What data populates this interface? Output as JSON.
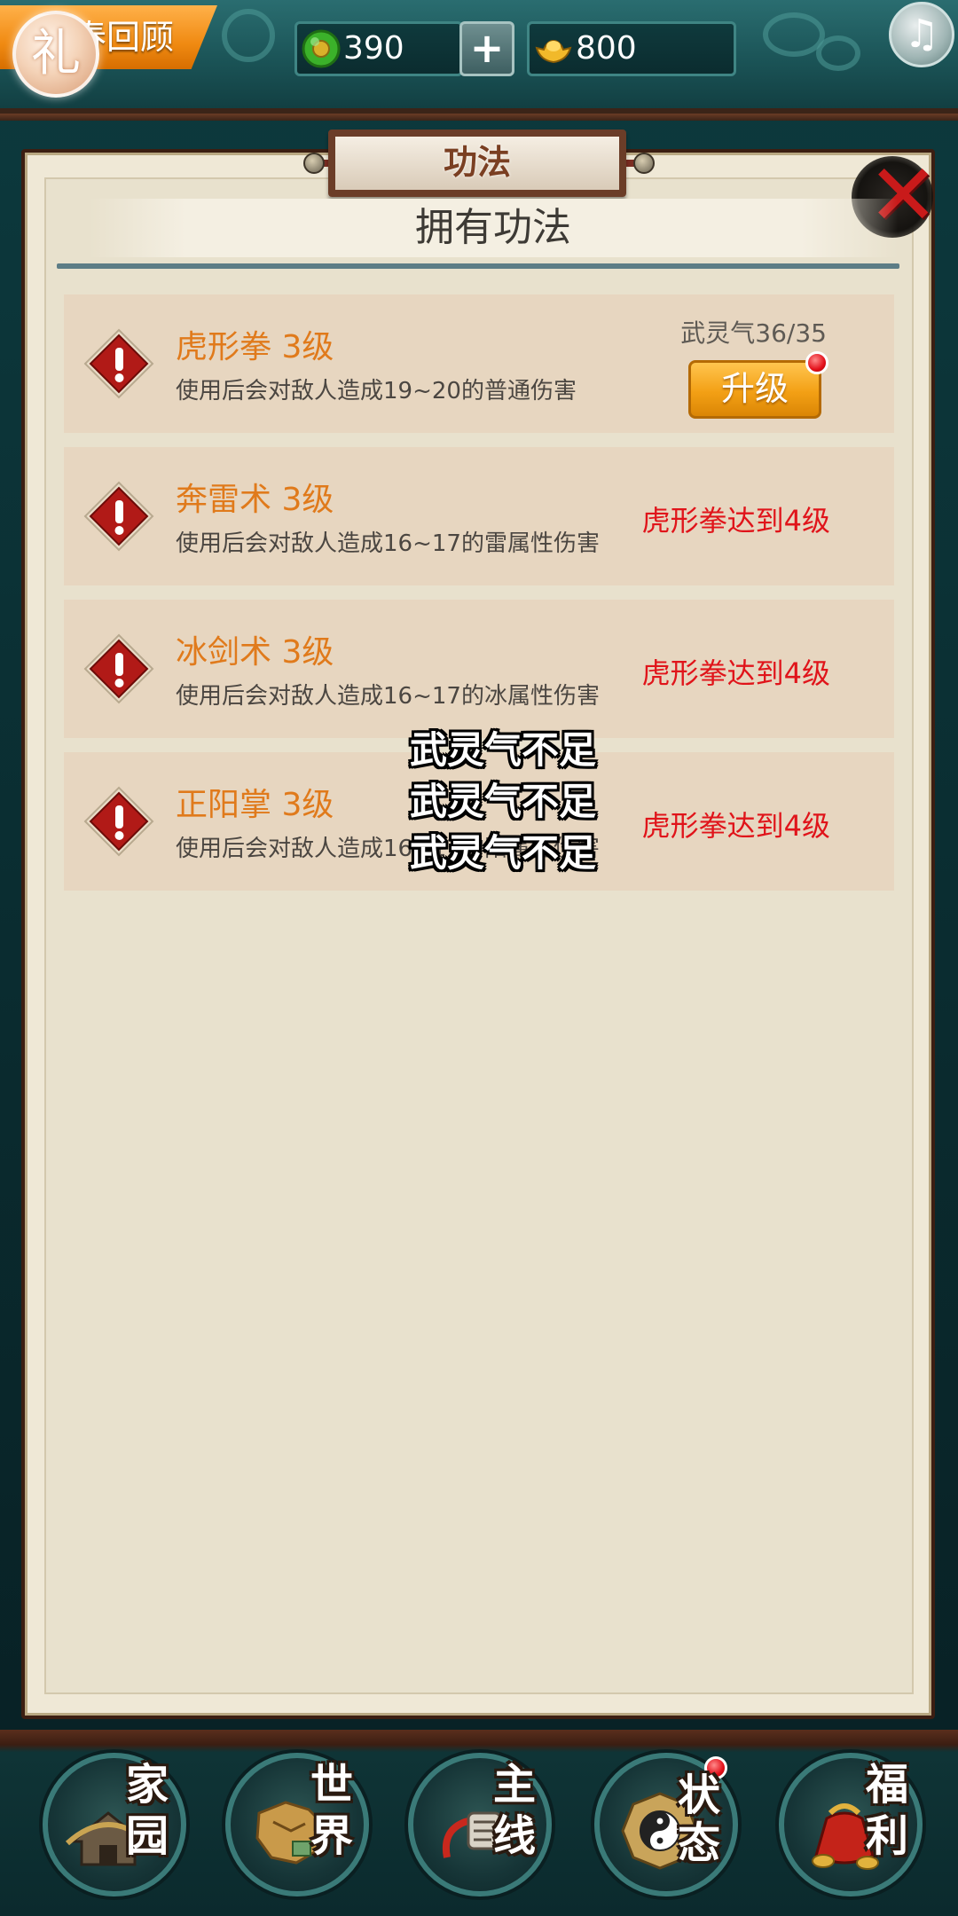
{
  "top_bar": {
    "event_label": "春回顾",
    "gift_icon_char": "礼",
    "jade_amount": "390",
    "plus_label": "+",
    "gold_amount": "800",
    "music_icon_char": "♫"
  },
  "panel": {
    "title": "功法",
    "section_header": "拥有功法",
    "close_icon_char": "✕"
  },
  "skills": [
    {
      "name": "虎形拳 3级",
      "description": "使用后会对敌人造成19~20的普通伤害",
      "qi_label": "武灵气36/35",
      "upgrade_label": "升级"
    },
    {
      "name": "奔雷术 3级",
      "description": "使用后会对敌人造成16~17的雷属性伤害",
      "requirement": "虎形拳达到4级"
    },
    {
      "name": "冰剑术 3级",
      "description": "使用后会对敌人造成16~17的冰属性伤害",
      "requirement": "虎形拳达到4级"
    },
    {
      "name": "正阳掌 3级",
      "description": "使用后会对敌人造成16~17的阳属性伤害",
      "requirement": "虎形拳达到4级"
    }
  ],
  "toasts": [
    "武灵气不足",
    "武灵气不足",
    "武灵气不足"
  ],
  "bottom_nav": [
    {
      "label_top": "家",
      "label_bottom": "园",
      "icon": "home-icon"
    },
    {
      "label_top": "世",
      "label_bottom": "界",
      "icon": "world-map-icon"
    },
    {
      "label_top": "主",
      "label_bottom": "线",
      "icon": "main-quest-icon"
    },
    {
      "label_top": "状",
      "label_bottom": "态",
      "icon": "status-icon"
    },
    {
      "label_top": "福",
      "label_bottom": "利",
      "icon": "welfare-bag-icon"
    }
  ],
  "colors": {
    "accent_orange": "#e07a1b",
    "requirement_red": "#e0141a",
    "panel_bg": "#e8e1cd",
    "row_bg": "#e7d6c0",
    "frame_teal": "#1b5457"
  }
}
